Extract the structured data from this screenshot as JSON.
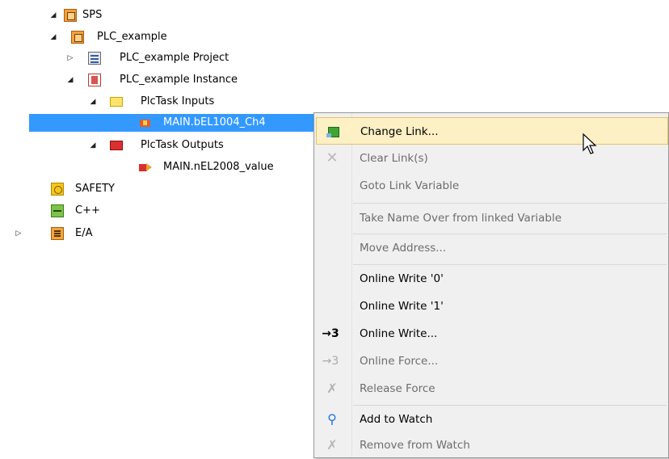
{
  "tree": {
    "sps": "SPS",
    "plc_example": "PLC_example",
    "plc_project": "PLC_example Project",
    "plc_instance": "PLC_example Instance",
    "plctask_inputs": "PlcTask Inputs",
    "var_input": "MAIN.bEL1004_Ch4",
    "plctask_outputs": "PlcTask Outputs",
    "var_output": "MAIN.nEL2008_value",
    "safety": "SAFETY",
    "cpp": "C++",
    "ea": "E/A"
  },
  "context_menu": {
    "change_link": "Change Link...",
    "clear_links": "Clear Link(s)",
    "goto_link": "Goto Link Variable",
    "take_name": "Take Name Over from linked Variable",
    "move_address": "Move Address...",
    "write0": "Online Write '0'",
    "write1": "Online Write '1'",
    "online_write": "Online Write...",
    "online_force": "Online Force...",
    "release_force": "Release Force",
    "add_watch": "Add to Watch",
    "remove_watch": "Remove from Watch",
    "arrow3_active": "→3",
    "arrow3_disabled": "→3"
  },
  "colors": {
    "selection": "#3399ff",
    "menu_hover": "#fcf0c4"
  }
}
